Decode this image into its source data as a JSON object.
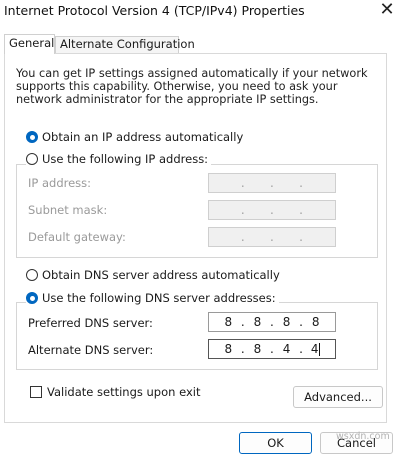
{
  "window": {
    "title": "Internet Protocol Version 4 (TCP/IPv4) Properties",
    "close_glyph": "✕"
  },
  "tabs": [
    {
      "label": "General",
      "selected": true
    },
    {
      "label": "Alternate Configuration",
      "selected": false
    }
  ],
  "description": "You can get IP settings assigned automatically if your network supports this capability. Otherwise, you need to ask your network administrator for the appropriate IP settings.",
  "ip_section": {
    "auto_option": {
      "label": "Obtain an IP address automatically",
      "checked": true
    },
    "manual_option": {
      "label": "Use the following IP address:",
      "checked": false
    },
    "fields": [
      {
        "label": "IP address:",
        "value": [
          "",
          "",
          "",
          ""
        ],
        "enabled": false
      },
      {
        "label": "Subnet mask:",
        "value": [
          "",
          "",
          "",
          ""
        ],
        "enabled": false
      },
      {
        "label": "Default gateway:",
        "value": [
          "",
          "",
          "",
          ""
        ],
        "enabled": false
      }
    ]
  },
  "dns_section": {
    "auto_option": {
      "label": "Obtain DNS server address automatically",
      "checked": false
    },
    "manual_option": {
      "label": "Use the following DNS server addresses:",
      "checked": true
    },
    "preferred": {
      "label": "Preferred DNS server:",
      "octets": [
        "8",
        "8",
        "8",
        "8"
      ]
    },
    "alternate": {
      "label": "Alternate DNS server:",
      "octets": [
        "8",
        "8",
        "4",
        "4"
      ]
    }
  },
  "validate": {
    "label": "Validate settings upon exit",
    "checked": false
  },
  "buttons": {
    "advanced": "Advanced...",
    "ok": "OK",
    "cancel": "Cancel"
  },
  "watermark": "wsxdn.com",
  "colors": {
    "accent": "#0067c0",
    "disabled_text": "#9a9a9a",
    "disabled_field": "#f0f0f0"
  }
}
